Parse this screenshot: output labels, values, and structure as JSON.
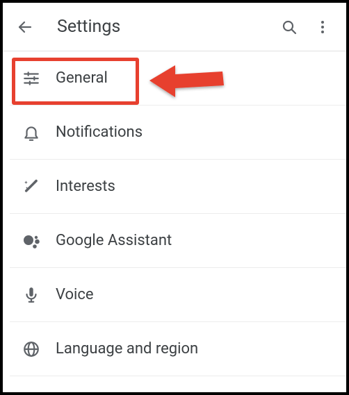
{
  "header": {
    "title": "Settings"
  },
  "items": [
    {
      "label": "General"
    },
    {
      "label": "Notifications"
    },
    {
      "label": "Interests"
    },
    {
      "label": "Google Assistant"
    },
    {
      "label": "Voice"
    },
    {
      "label": "Language and region"
    }
  ]
}
